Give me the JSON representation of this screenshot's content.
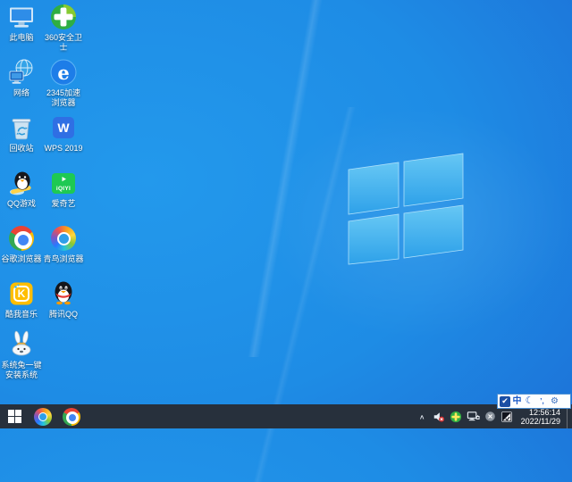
{
  "wallpaper": {
    "base_color": "#1e8ce5",
    "edge_color": "#1a4ec2",
    "logo_pane_color": "#45b2ec"
  },
  "desktop": {
    "icons": [
      {
        "id": "this-pc",
        "label": "此电脑"
      },
      {
        "id": "360-safe",
        "label": "360安全卫士"
      },
      {
        "id": "network",
        "label": "网络"
      },
      {
        "id": "2345-browser",
        "label": "2345加速浏览器"
      },
      {
        "id": "recycle-bin",
        "label": "回收站"
      },
      {
        "id": "wps-2019",
        "label": "WPS 2019"
      },
      {
        "id": "qq-games",
        "label": "QQ游戏"
      },
      {
        "id": "iqiyi",
        "label": "爱奇艺"
      },
      {
        "id": "google-chrome",
        "label": "谷歌浏览器"
      },
      {
        "id": "qingniao-browser",
        "label": "青鸟浏览器"
      },
      {
        "id": "kuwo-music",
        "label": "酷我音乐"
      },
      {
        "id": "tencent-qq",
        "label": "腾讯QQ"
      },
      {
        "id": "system-rabbit",
        "label": "系统兔一键安装系统"
      }
    ]
  },
  "glyphs": {
    "e2345": "e",
    "wps_w": "W",
    "iqiyi_text": "iQIYI",
    "kuwo_k": "K"
  },
  "taskbar": {
    "color": "#27303c",
    "pinned": [
      {
        "id": "qingniao-browser"
      },
      {
        "id": "google-chrome"
      }
    ],
    "tray": {
      "chevron_glyph": "∧"
    },
    "clock": {
      "time": "12:56:14",
      "date": "2022/11/29"
    }
  },
  "ime": {
    "items": [
      {
        "id": "ime-logo",
        "glyph": "✔"
      },
      {
        "id": "chinese-mode",
        "glyph": "中"
      },
      {
        "id": "moon-mode",
        "glyph": "☾"
      },
      {
        "id": "punctuation",
        "glyph": "’,"
      },
      {
        "id": "settings",
        "glyph": "⚙"
      }
    ]
  }
}
